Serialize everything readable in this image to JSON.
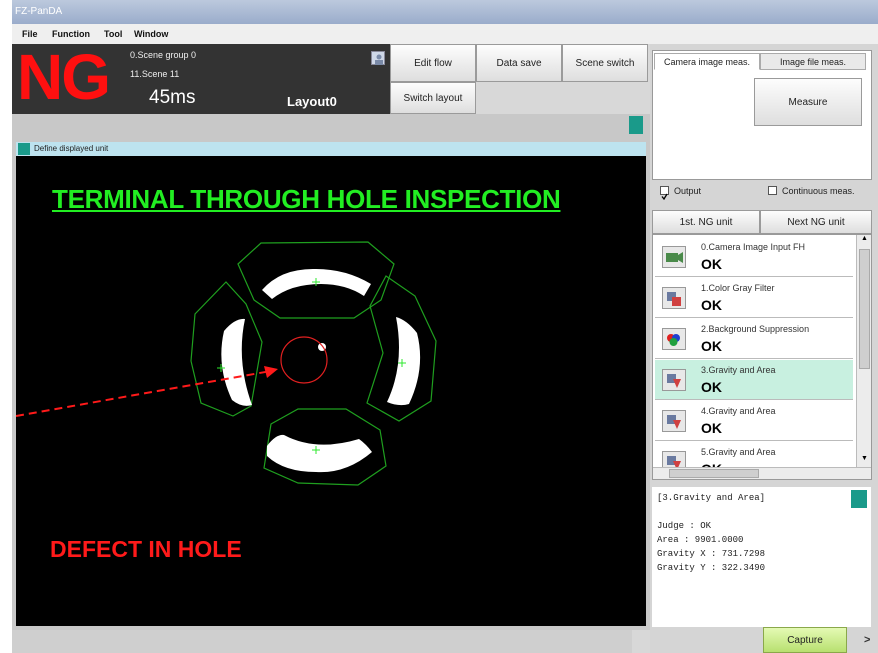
{
  "app": {
    "title": "FZ-PanDA"
  },
  "menu": [
    "File",
    "Function",
    "Tool",
    "Window"
  ],
  "status": {
    "judge": "NG",
    "scene_group": "0.Scene group 0",
    "scene": "11.Scene 11",
    "time": "45ms",
    "layout": "Layout0"
  },
  "toolbar": {
    "edit_flow": "Edit flow",
    "data_save": "Data save",
    "scene_switch": "Scene switch",
    "switch_layout": "Switch layout"
  },
  "display": {
    "header": "Define displayed unit",
    "heading": "TERMINAL THROUGH HOLE INSPECTION",
    "defect_label": "DEFECT IN HOLE"
  },
  "measure": {
    "tab_camera": "Camera image meas.",
    "tab_file": "Image file meas.",
    "button": "Measure",
    "output_label": "Output",
    "output_checked": true,
    "continuous_label": "Continuous meas.",
    "continuous_checked": false
  },
  "ng_nav": {
    "first": "1st. NG unit",
    "next": "Next NG unit"
  },
  "units": [
    {
      "name": "0.Camera Image Input FH",
      "judge": "OK",
      "icon": "camera-icon"
    },
    {
      "name": "1.Color Gray Filter",
      "judge": "OK",
      "icon": "filter-icon"
    },
    {
      "name": "2.Background Suppression",
      "judge": "OK",
      "icon": "background-suppression-icon"
    },
    {
      "name": "3.Gravity and Area",
      "judge": "OK",
      "icon": "gravity-area-icon",
      "selected": true
    },
    {
      "name": "4.Gravity and Area",
      "judge": "OK",
      "icon": "gravity-area-icon"
    },
    {
      "name": "5.Gravity and Area",
      "judge": "OK",
      "icon": "gravity-area-icon"
    }
  ],
  "detail": {
    "title": "[3.Gravity and Area]",
    "judge": "Judge : OK",
    "area": "Area : 9901.0000",
    "gx": "Gravity X : 731.7298",
    "gy": "Gravity Y : 322.3490"
  },
  "capture": "Capture",
  "colors": {
    "ng": "#ff1010",
    "heading": "#22ee22",
    "selected_row": "#c8f0e0",
    "teal": "#1a9a8a",
    "annotation": "#ff1a1a"
  }
}
